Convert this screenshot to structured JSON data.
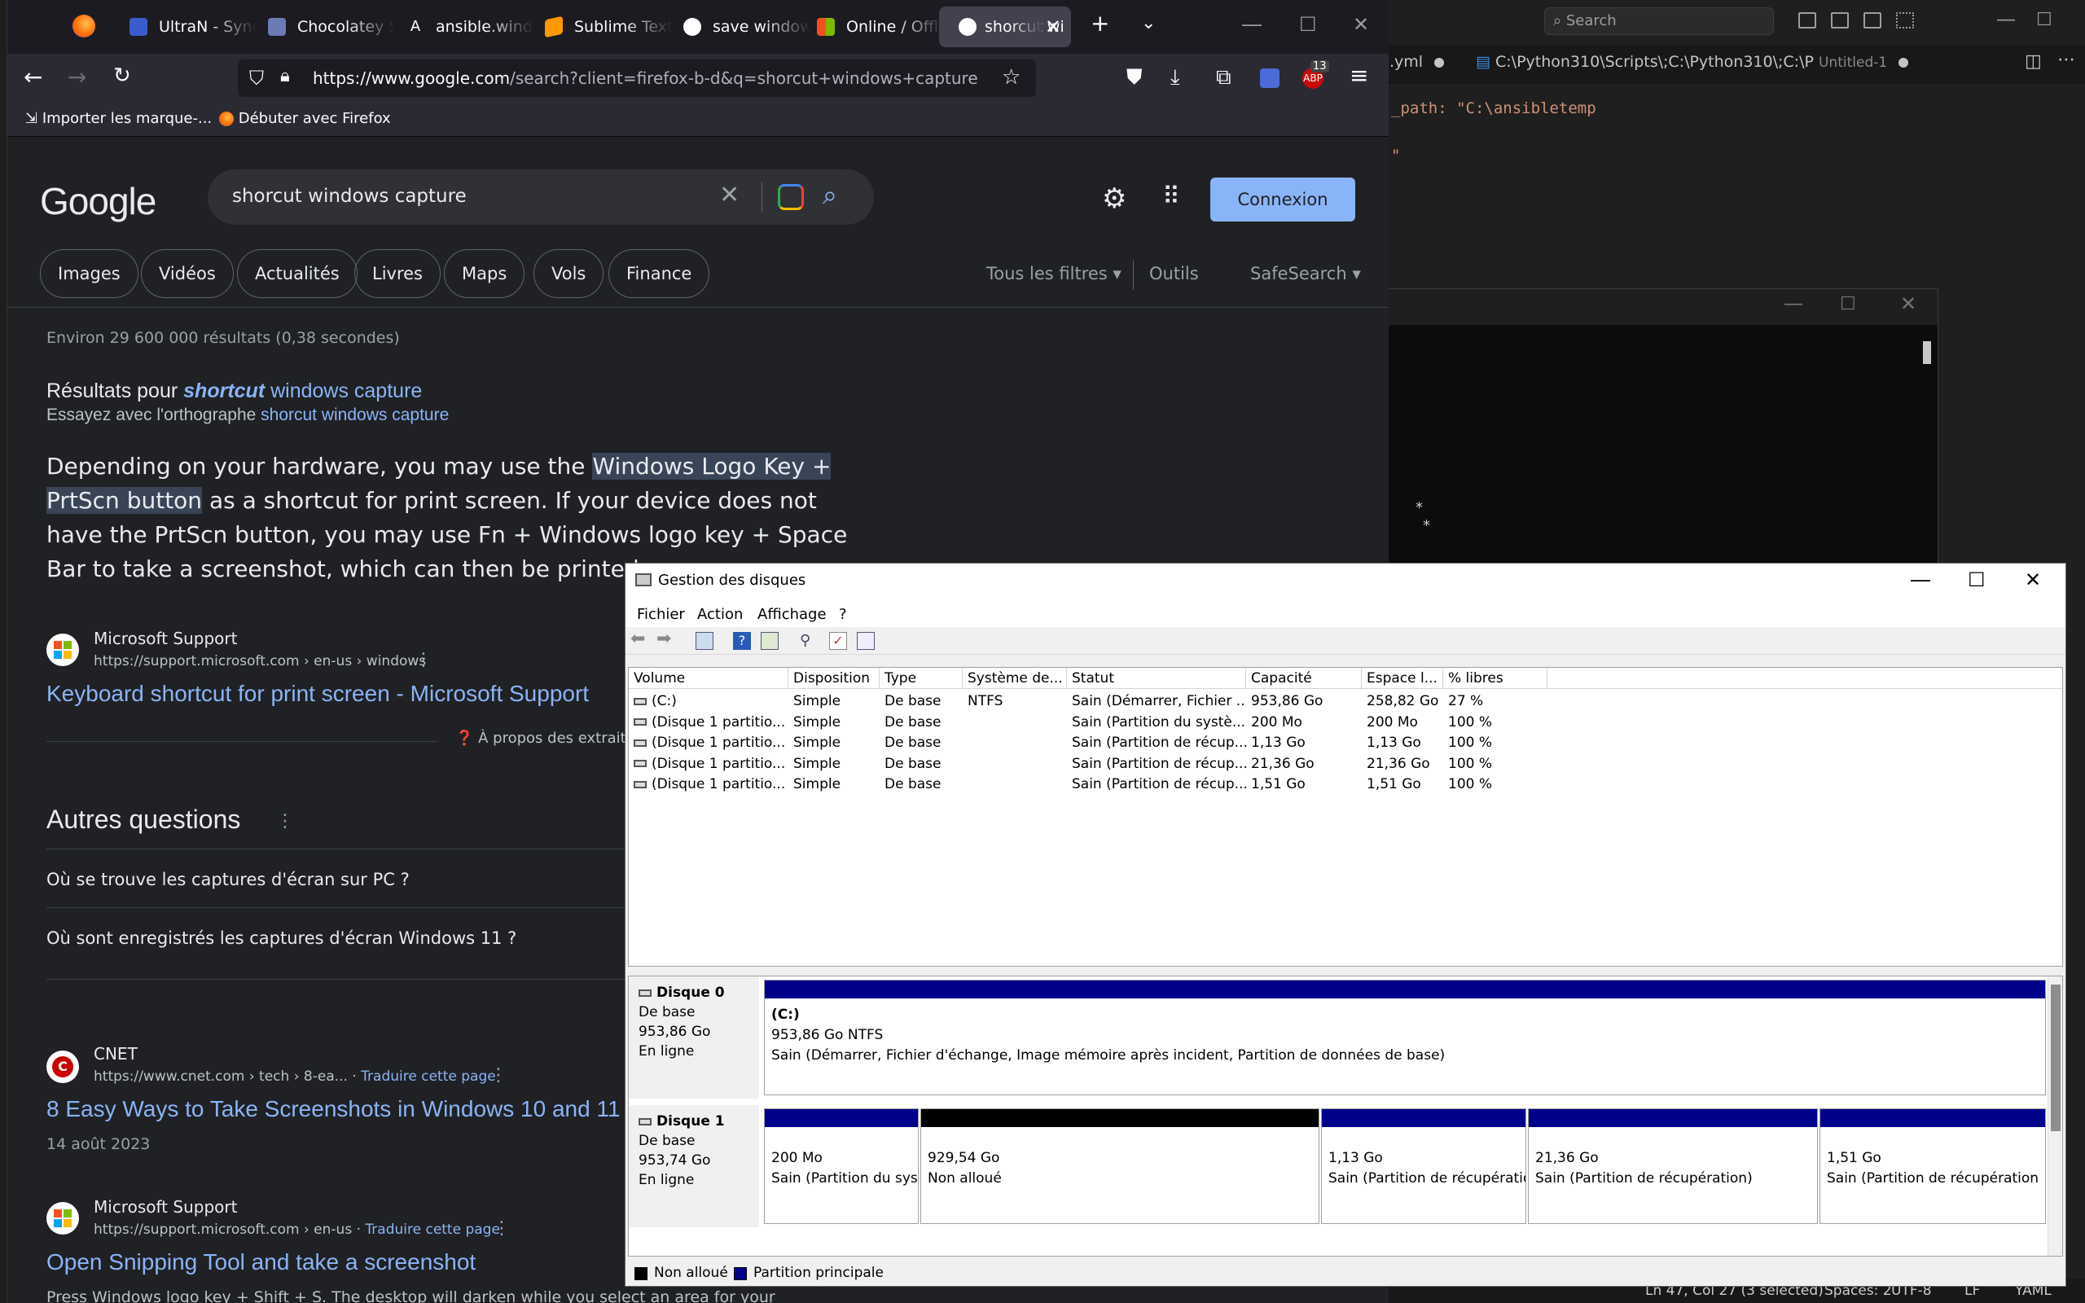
{
  "vscode": {
    "search_placeholder": "Search",
    "tabs": [
      {
        "label": ".yml"
      },
      {
        "label": "C:\\Python310\\Scripts\\;C:\\Python310\\;C:\\P",
        "sublabel": "Untitled-1"
      }
    ],
    "code_lines": [
      "_path: \"C:\\ansibletemp",
      "\""
    ],
    "terminal_stars": [
      "*",
      "*"
    ],
    "status": {
      "position": "Ln 47, Col 27 (3 selected)",
      "spaces": "Spaces: 2",
      "encoding": "UTF-8",
      "eol": "LF",
      "language": "YAML"
    }
  },
  "firefox": {
    "tabs": [
      {
        "label": "UltraN - Sync",
        "color": "#3b5ccc"
      },
      {
        "label": "Chocolatey S",
        "color": "#6b7bb5"
      },
      {
        "label": "ansible.windo",
        "color": "#1c1b22"
      },
      {
        "label": "Sublime Text",
        "color": "#ff9800"
      },
      {
        "label": "save window",
        "color": "#ffffff"
      },
      {
        "label": "Online / Offli",
        "color": "#f25022"
      },
      {
        "label": "shorcut wi",
        "color": "#ffffff",
        "active": true
      }
    ],
    "url_host": "https://www.google.com",
    "url_rest": "/search?client=firefox-b-d&q=shorcut+windows+capture",
    "badge_count": "13",
    "bookmarks": [
      "Importer les marque-...",
      "Débuter avec Firefox"
    ]
  },
  "google": {
    "logo": "Google",
    "query": "shorcut windows capture",
    "connexion_label": "Connexion",
    "chips": [
      "Images",
      "Vidéos",
      "Actualités",
      "Livres",
      "Maps",
      "Vols",
      "Finance"
    ],
    "tools": {
      "all_filters": "Tous les filtres",
      "tools": "Outils",
      "safesearch": "SafeSearch"
    },
    "result_stats": "Environ 29 600 000 résultats (0,38 secondes)",
    "spelling": {
      "prefix": "Résultats pour ",
      "corrected_bold": "shortcut",
      "corrected_rest": " windows capture",
      "try_prefix": "Essayez avec l'orthographe ",
      "try_link": "shorcut windows capture"
    },
    "snippet": {
      "before": "Depending on your hardware, you may use the ",
      "highlight_1": "Windows Logo Key +",
      "highlight_2": "PrtScn button",
      "line2_rest": " as a shortcut for print screen. If your device does not",
      "line3": "have the PrtScn button, you may use Fn + Windows logo key + Space",
      "line4": "Bar to take a screenshot, which can then be printed."
    },
    "featured": {
      "site": "Microsoft Support",
      "url": "https://support.microsoft.com › en-us › windows",
      "title": "Keyboard shortcut for print screen - Microsoft Support",
      "about": "À propos des extraits"
    },
    "paa_title": "Autres questions",
    "paa": [
      "Où se trouve les captures d'écran sur PC ?",
      "Où sont enregistrés les captures d'écran Windows 11 ?"
    ],
    "results": [
      {
        "site": "CNET",
        "url": "https://www.cnet.com › tech › 8-ea...",
        "translate": "Traduire cette page",
        "title": "8 Easy Ways to Take Screenshots in Windows 10 and 11",
        "date": "14 août 2023"
      },
      {
        "site": "Microsoft Support",
        "url": "https://support.microsoft.com › en-us",
        "translate": "Traduire cette page",
        "title": "Open Snipping Tool and take a screenshot",
        "snippet": "Press Windows logo key + Shift + S. The desktop will darken while you select an area for your"
      }
    ]
  },
  "diskmgmt": {
    "title": "Gestion des disques",
    "menu": [
      "Fichier",
      "Action",
      "Affichage",
      "?"
    ],
    "columns": [
      "Volume",
      "Disposition",
      "Type",
      "Système de...",
      "Statut",
      "Capacité",
      "Espace l...",
      "% libres"
    ],
    "rows": [
      [
        "(C:)",
        "Simple",
        "De base",
        "NTFS",
        "Sain (Démarrer, Fichier ...",
        "953,86 Go",
        "258,82 Go",
        "27 %"
      ],
      [
        "(Disque 1 partitio...",
        "Simple",
        "De base",
        "",
        "Sain (Partition du systè...",
        "200 Mo",
        "200 Mo",
        "100 %"
      ],
      [
        "(Disque 1 partitio...",
        "Simple",
        "De base",
        "",
        "Sain (Partition de récup...",
        "1,13 Go",
        "1,13 Go",
        "100 %"
      ],
      [
        "(Disque 1 partitio...",
        "Simple",
        "De base",
        "",
        "Sain (Partition de récup...",
        "21,36 Go",
        "21,36 Go",
        "100 %"
      ],
      [
        "(Disque 1 partitio...",
        "Simple",
        "De base",
        "",
        "Sain (Partition de récup...",
        "1,51 Go",
        "1,51 Go",
        "100 %"
      ]
    ],
    "disks": [
      {
        "name": "Disque 0",
        "type": "De base",
        "size": "953,86 Go",
        "state": "En ligne",
        "partitions": [
          {
            "name": "(C:)",
            "line1": "953,86 Go NTFS",
            "line2": "Sain (Démarrer, Fichier d'échange, Image mémoire après incident, Partition de données de base)"
          }
        ]
      },
      {
        "name": "Disque 1",
        "type": "De base",
        "size": "953,74 Go",
        "state": "En ligne",
        "partitions": [
          {
            "line1": "200 Mo",
            "line2": "Sain (Partition du sys"
          },
          {
            "line1": "929,54 Go",
            "line2": "Non alloué"
          },
          {
            "line1": "1,13 Go",
            "line2": "Sain (Partition de récupératic"
          },
          {
            "line1": "21,36 Go",
            "line2": "Sain (Partition de récupération)"
          },
          {
            "line1": "1,51 Go",
            "line2": "Sain (Partition de récupération"
          }
        ]
      }
    ],
    "legend": [
      "Non alloué",
      "Partition principale"
    ],
    "colors": {
      "primary": "#00008b",
      "unallocated": "#000000"
    }
  }
}
